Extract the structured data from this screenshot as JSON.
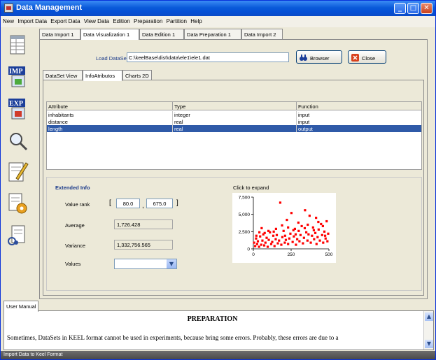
{
  "window": {
    "title": "Data Management"
  },
  "menu": [
    "New",
    "Import Data",
    "Export Data",
    "View Data",
    "Edition",
    "Preparation",
    "Partition",
    "Help"
  ],
  "sidebar": {
    "tools": [
      "table-icon",
      "import-icon",
      "export-icon",
      "magnifier-icon",
      "edit-pencil-icon",
      "preparation-icon",
      "partition-icon"
    ],
    "imp_label": "IMP",
    "exp_label": "EXP"
  },
  "top_tabs": [
    "Data Import 1",
    "Data Visualization 1",
    "Data Edition 1",
    "Data Preparation 1",
    "Data Import 2"
  ],
  "top_tabs_active": 1,
  "load": {
    "label": "Load DataSet",
    "path": "C:\\keelBase\\dist\\data\\ele1\\ele1.dat",
    "browse_label": "Browser",
    "close_label": "Close"
  },
  "inner_tabs": [
    "DataSet View",
    "InfoAtributos",
    "Charts 2D"
  ],
  "inner_tabs_active": 1,
  "table": {
    "headers": [
      "Attribute",
      "Type",
      "Function"
    ],
    "rows": [
      [
        "inhabitants",
        "integer",
        "input"
      ],
      [
        "distance",
        "real",
        "input"
      ],
      [
        "length",
        "real",
        "output"
      ]
    ],
    "selected_row": 2
  },
  "extended": {
    "title": "Extended Info",
    "value_rank_label": "Value rank",
    "rank_open": "[",
    "rank_min": "80.0",
    "rank_sep": ",",
    "rank_max": "675.0",
    "rank_close": "]",
    "average_label": "Average",
    "average_value": "1,726.428",
    "variance_label": "Variance",
    "variance_value": "1,332,756.565",
    "values_label": "Values",
    "values_selected": "",
    "chart_hint": "Click to expand"
  },
  "chart_data": {
    "type": "scatter",
    "xlim": [
      0,
      500
    ],
    "ylim": [
      0,
      7500
    ],
    "xticks": [
      "0",
      "250",
      "500"
    ],
    "yticks": [
      "0",
      "2,500",
      "5,000",
      "7,500"
    ],
    "color": "#ff0000",
    "points": [
      [
        5,
        900
      ],
      [
        12,
        400
      ],
      [
        18,
        1500
      ],
      [
        25,
        700
      ],
      [
        30,
        1100
      ],
      [
        38,
        300
      ],
      [
        45,
        1800
      ],
      [
        52,
        600
      ],
      [
        60,
        1200
      ],
      [
        66,
        2100
      ],
      [
        72,
        500
      ],
      [
        80,
        900
      ],
      [
        88,
        1600
      ],
      [
        95,
        300
      ],
      [
        102,
        1300
      ],
      [
        110,
        2400
      ],
      [
        118,
        700
      ],
      [
        125,
        1000
      ],
      [
        132,
        1900
      ],
      [
        140,
        400
      ],
      [
        148,
        1400
      ],
      [
        155,
        2000
      ],
      [
        162,
        800
      ],
      [
        170,
        1200
      ],
      [
        178,
        6700
      ],
      [
        185,
        600
      ],
      [
        192,
        1700
      ],
      [
        200,
        2600
      ],
      [
        208,
        900
      ],
      [
        215,
        1300
      ],
      [
        222,
        4200
      ],
      [
        230,
        700
      ],
      [
        238,
        1500
      ],
      [
        245,
        2200
      ],
      [
        252,
        5200
      ],
      [
        260,
        1000
      ],
      [
        268,
        1800
      ],
      [
        275,
        2900
      ],
      [
        282,
        600
      ],
      [
        290,
        1400
      ],
      [
        298,
        3800
      ],
      [
        305,
        1100
      ],
      [
        312,
        2000
      ],
      [
        320,
        3300
      ],
      [
        328,
        800
      ],
      [
        335,
        1600
      ],
      [
        342,
        5600
      ],
      [
        350,
        2400
      ],
      [
        358,
        1200
      ],
      [
        365,
        2100
      ],
      [
        372,
        4800
      ],
      [
        380,
        900
      ],
      [
        388,
        1900
      ],
      [
        395,
        3100
      ],
      [
        402,
        1400
      ],
      [
        410,
        2300
      ],
      [
        418,
        700
      ],
      [
        425,
        1700
      ],
      [
        432,
        2800
      ],
      [
        440,
        1200
      ],
      [
        448,
        3600
      ],
      [
        455,
        2000
      ],
      [
        462,
        900
      ],
      [
        470,
        2500
      ],
      [
        478,
        1500
      ],
      [
        485,
        4000
      ],
      [
        490,
        1100
      ],
      [
        495,
        2200
      ],
      [
        55,
        3000
      ],
      [
        190,
        3400
      ],
      [
        265,
        2700
      ],
      [
        340,
        3000
      ],
      [
        415,
        4500
      ],
      [
        430,
        3900
      ],
      [
        150,
        2900
      ],
      [
        100,
        2600
      ],
      [
        230,
        3100
      ],
      [
        300,
        2600
      ],
      [
        20,
        1900
      ],
      [
        75,
        2300
      ],
      [
        135,
        2500
      ],
      [
        210,
        1900
      ],
      [
        280,
        2100
      ],
      [
        360,
        3500
      ],
      [
        400,
        2700
      ],
      [
        460,
        3300
      ],
      [
        475,
        1900
      ],
      [
        40,
        2400
      ]
    ]
  },
  "manual": {
    "tab_label": "User Manual",
    "heading": "PREPARATION",
    "text": "Sometimes, DataSets in KEEL format cannot be used in experiments, because bring some errors. Probably, these errors are due to a"
  },
  "status": {
    "text": "Import Data to Keel Format"
  }
}
